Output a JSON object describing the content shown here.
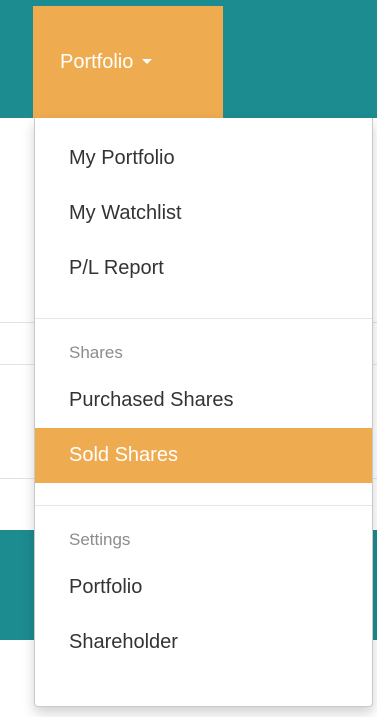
{
  "nav": {
    "toggle_label": "Portfolio"
  },
  "dropdown": {
    "group1": [
      {
        "label": "My Portfolio"
      },
      {
        "label": "My Watchlist"
      },
      {
        "label": "P/L Report"
      }
    ],
    "shares_header": "Shares",
    "shares": [
      {
        "label": "Purchased Shares"
      },
      {
        "label": "Sold Shares"
      }
    ],
    "settings_header": "Settings",
    "settings": [
      {
        "label": "Portfolio"
      },
      {
        "label": "Shareholder"
      }
    ]
  },
  "colors": {
    "navbar_teal": "#1c8c91",
    "accent_orange": "#efab4f"
  }
}
